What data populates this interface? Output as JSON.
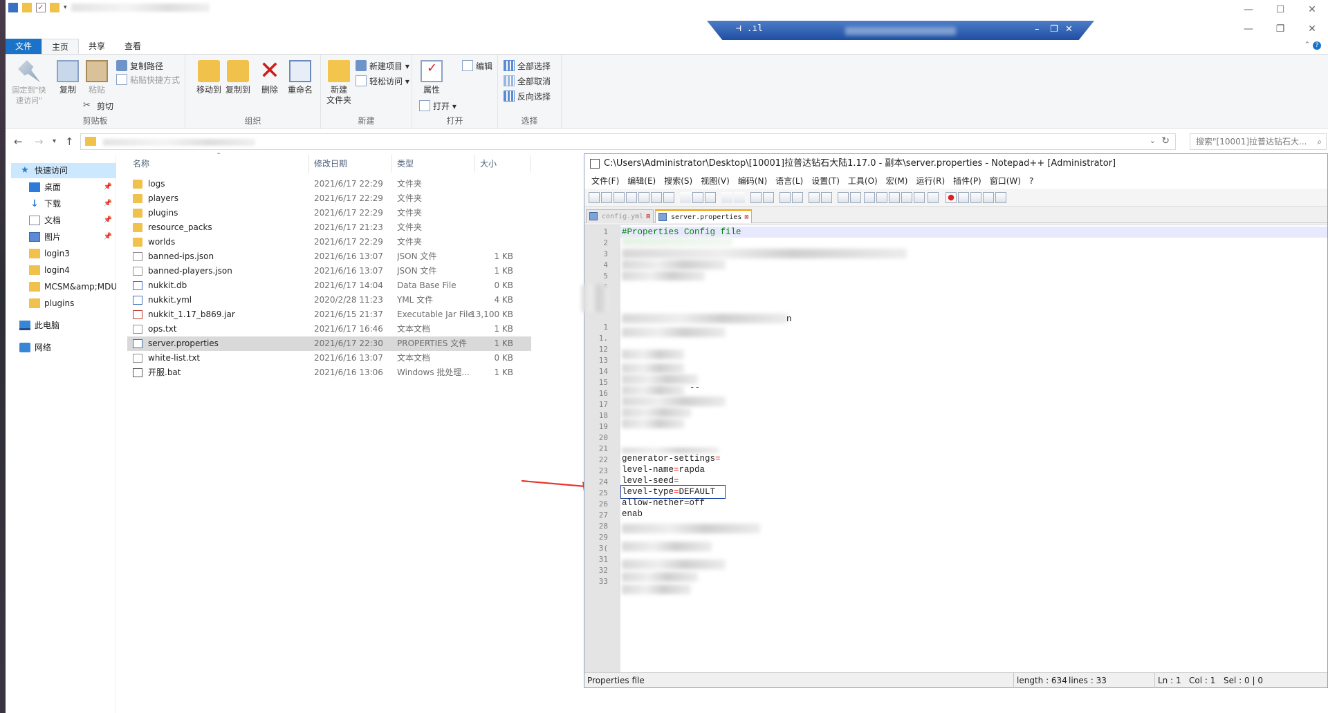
{
  "explorer": {
    "ribbon_tabs": [
      "文件",
      "主页",
      "共享",
      "查看"
    ],
    "ribbon": {
      "clipboard": {
        "pin_label": "固定到\"快\n速访问\"",
        "copy_label": "复制",
        "paste_label": "粘贴",
        "copy_path": "复制路径",
        "paste_shortcut": "粘贴快捷方式",
        "cut": "剪切",
        "group": "剪贴板"
      },
      "organize": {
        "move_to": "移动到",
        "copy_to": "复制到",
        "delete": "删除",
        "rename": "重命名",
        "group": "组织"
      },
      "new": {
        "new_folder": "新建\n文件夹",
        "new_item": "新建项目 ▾",
        "easy_access": "轻松访问 ▾",
        "group": "新建"
      },
      "open": {
        "properties": "属性",
        "open": "打开 ▾",
        "edit": "编辑",
        "group": "打开"
      },
      "select": {
        "select_all": "全部选择",
        "select_none": "全部取消",
        "invert": "反向选择",
        "group": "选择"
      }
    },
    "search_placeholder": "搜索\"[10001]拉普达钻石大...",
    "nav": {
      "quick_access": "快速访问",
      "items": [
        "桌面",
        "下载",
        "文档",
        "图片",
        "login3",
        "login4",
        "MCSM&amp;MDU",
        "plugins"
      ],
      "this_pc": "此电脑",
      "network": "网络"
    },
    "columns": [
      "名称",
      "修改日期",
      "类型",
      "大小"
    ],
    "files": [
      {
        "name": "logs",
        "date": "2021/6/17 22:29",
        "type": "文件夹",
        "size": "",
        "kind": "folder"
      },
      {
        "name": "players",
        "date": "2021/6/17 22:29",
        "type": "文件夹",
        "size": "",
        "kind": "folder"
      },
      {
        "name": "plugins",
        "date": "2021/6/17 22:29",
        "type": "文件夹",
        "size": "",
        "kind": "folder"
      },
      {
        "name": "resource_packs",
        "date": "2021/6/17 21:23",
        "type": "文件夹",
        "size": "",
        "kind": "folder"
      },
      {
        "name": "worlds",
        "date": "2021/6/17 22:29",
        "type": "文件夹",
        "size": "",
        "kind": "folder"
      },
      {
        "name": "banned-ips.json",
        "date": "2021/6/16 13:07",
        "type": "JSON 文件",
        "size": "1 KB",
        "kind": "file"
      },
      {
        "name": "banned-players.json",
        "date": "2021/6/16 13:07",
        "type": "JSON 文件",
        "size": "1 KB",
        "kind": "file"
      },
      {
        "name": "nukkit.db",
        "date": "2021/6/17 14:04",
        "type": "Data Base File",
        "size": "0 KB",
        "kind": "db"
      },
      {
        "name": "nukkit.yml",
        "date": "2020/2/28 11:23",
        "type": "YML 文件",
        "size": "4 KB",
        "kind": "db"
      },
      {
        "name": "nukkit_1.17_b869.jar",
        "date": "2021/6/15 21:37",
        "type": "Executable Jar File",
        "size": "13,100 KB",
        "kind": "jar"
      },
      {
        "name": "ops.txt",
        "date": "2021/6/17 16:46",
        "type": "文本文档",
        "size": "1 KB",
        "kind": "file"
      },
      {
        "name": "server.properties",
        "date": "2021/6/17 22:30",
        "type": "PROPERTIES 文件",
        "size": "1 KB",
        "kind": "db",
        "selected": true
      },
      {
        "name": "white-list.txt",
        "date": "2021/6/16 13:07",
        "type": "文本文档",
        "size": "0 KB",
        "kind": "file"
      },
      {
        "name": "开服.bat",
        "date": "2021/6/16 13:06",
        "type": "Windows 批处理...",
        "size": "1 KB",
        "kind": "bat"
      }
    ]
  },
  "notepad": {
    "title": "C:\\Users\\Administrator\\Desktop\\[10001]拉普达钻石大陆1.17.0 - 副本\\server.properties - Notepad++ [Administrator]",
    "menu": [
      "文件(F)",
      "编辑(E)",
      "搜索(S)",
      "视图(V)",
      "编码(N)",
      "语言(L)",
      "设置(T)",
      "工具(O)",
      "宏(M)",
      "运行(R)",
      "插件(P)",
      "窗口(W)",
      "?"
    ],
    "tabs": [
      {
        "label": "config.yml",
        "active": false
      },
      {
        "label": "server.properties",
        "active": true
      }
    ],
    "line_numbers": [
      "1",
      "2",
      "3",
      "4",
      "5",
      "6",
      "",
      "",
      "",
      "1",
      "1.",
      "12",
      "13",
      "14",
      "15",
      "16",
      "17",
      "18",
      "19",
      "20",
      "21",
      "22",
      "23",
      "24",
      "25",
      "26",
      "27",
      "28",
      "29",
      "3(",
      "31",
      "32",
      "33"
    ],
    "lines": {
      "l1": "#Properties Config file",
      "l21_key": "generator-settings",
      "l22_key": "level-name",
      "l22_val": "rapda",
      "l23_key": "level-seed",
      "l24_key": "level-type",
      "l24_val": "DEFAULT",
      "l25_key": "allow-nether",
      "l25_val": "off",
      "l26_key": "enab",
      "frag_n": "n",
      "frag_dash": "--"
    },
    "status": {
      "file_type": "Properties file",
      "length": "length : 634",
      "lines": "lines : 33",
      "ln": "Ln : 1",
      "col": "Col : 1",
      "sel": "Sel : 0 | 0"
    }
  },
  "colors": {
    "file_tab": "#1a73c8",
    "selection": "#d9d9d9",
    "comment": "#008000",
    "equals": "#ff0000",
    "arrow": "#e8322a"
  }
}
